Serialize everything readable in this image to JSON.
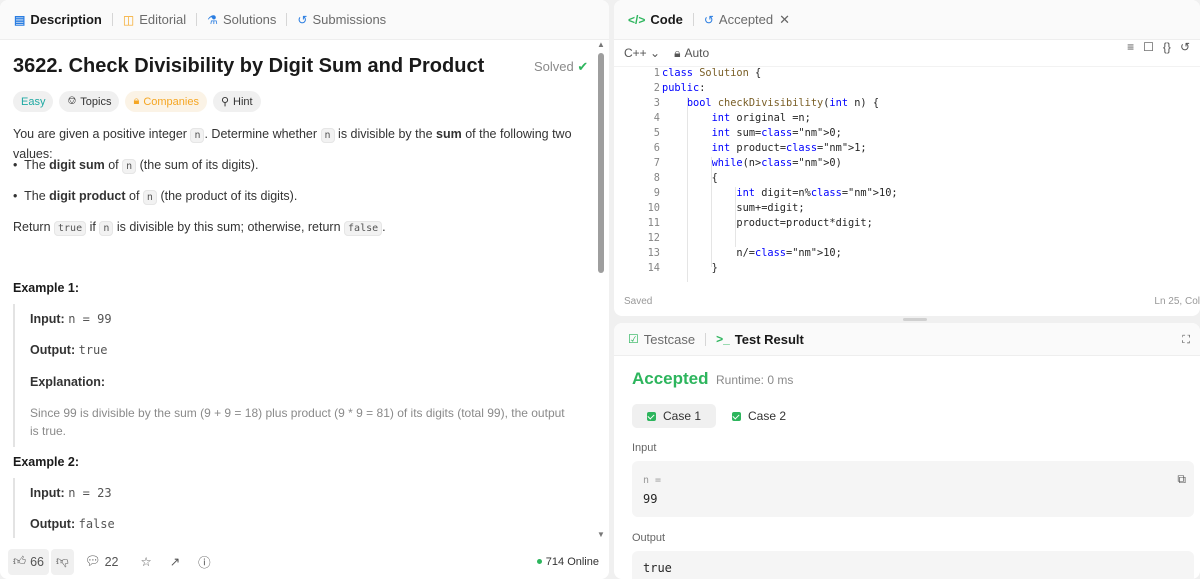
{
  "left_tabs": {
    "description": "Description",
    "editorial": "Editorial",
    "solutions": "Solutions",
    "submissions": "Submissions"
  },
  "problem": {
    "title": "3622. Check Divisibility by Digit Sum and Product",
    "status": "Solved",
    "tags": {
      "easy": "Easy",
      "topics": "Topics",
      "companies": "Companies",
      "hint": "Hint"
    },
    "intro_pre": "You are given a positive integer",
    "intro_var": "n",
    "intro_mid": ". Determine whether",
    "intro_var2": "n",
    "intro_mid2": "is divisible by the",
    "intro_bold": "sum",
    "intro_post": "of the following two values:",
    "bullet1_pre": "The",
    "bullet1_bold": "digit sum",
    "bullet1_mid": "of",
    "bullet1_var": "n",
    "bullet1_post": "(the sum of its digits).",
    "bullet2_pre": "The",
    "bullet2_bold": "digit product",
    "bullet2_mid": "of",
    "bullet2_var": "n",
    "bullet2_post": "(the product of its digits).",
    "ret_pre": "Return",
    "ret_true": "true",
    "ret_if": "if",
    "ret_var": "n",
    "ret_mid": "is divisible by this sum; otherwise, return",
    "ret_false": "false",
    "ret_end": "."
  },
  "examples": {
    "ex1_title": "Example 1:",
    "ex1_input_label": "Input:",
    "ex1_input": "n = 99",
    "ex1_output_label": "Output:",
    "ex1_output": "true",
    "ex1_expl_label": "Explanation:",
    "ex1_expl": "Since 99 is divisible by the sum (9 + 9 = 18) plus product (9 * 9 = 81) of its digits (total 99), the output is true.",
    "ex2_title": "Example 2:",
    "ex2_input_label": "Input:",
    "ex2_input": "n = 23",
    "ex2_output_label": "Output:",
    "ex2_output": "false"
  },
  "footer": {
    "likes": "66",
    "comments": "22",
    "online": "714 Online"
  },
  "code_panel": {
    "tab_code": "Code",
    "tab_accepted": "Accepted",
    "language": "C++",
    "auto": "Auto",
    "saved": "Saved",
    "cursor": "Ln 25, Col"
  },
  "code_lines": [
    {
      "n": "1",
      "text": "class Solution {"
    },
    {
      "n": "2",
      "text": "public:"
    },
    {
      "n": "3",
      "text": "    bool checkDivisibility(int n) {"
    },
    {
      "n": "4",
      "text": "        int original =n;"
    },
    {
      "n": "5",
      "text": "        int sum=0;"
    },
    {
      "n": "6",
      "text": "        int product=1;"
    },
    {
      "n": "7",
      "text": "        while(n>0)"
    },
    {
      "n": "8",
      "text": "        {"
    },
    {
      "n": "9",
      "text": "            int digit=n%10;"
    },
    {
      "n": "10",
      "text": "            sum+=digit;"
    },
    {
      "n": "11",
      "text": "            product=product*digit;"
    },
    {
      "n": "12",
      "text": ""
    },
    {
      "n": "13",
      "text": "            n/=10;"
    },
    {
      "n": "14",
      "text": "        }"
    }
  ],
  "result_panel": {
    "tab_testcase": "Testcase",
    "tab_result": "Test Result",
    "verdict": "Accepted",
    "runtime": "Runtime: 0 ms",
    "case1": "Case 1",
    "case2": "Case 2",
    "input_label": "Input",
    "var_label": "n =",
    "var_value": "99",
    "output_label": "Output",
    "output_value": "true"
  },
  "colors": {
    "accent_green": "#2db55d",
    "easy": "#1fa9a3",
    "companies": "#f5a623"
  }
}
